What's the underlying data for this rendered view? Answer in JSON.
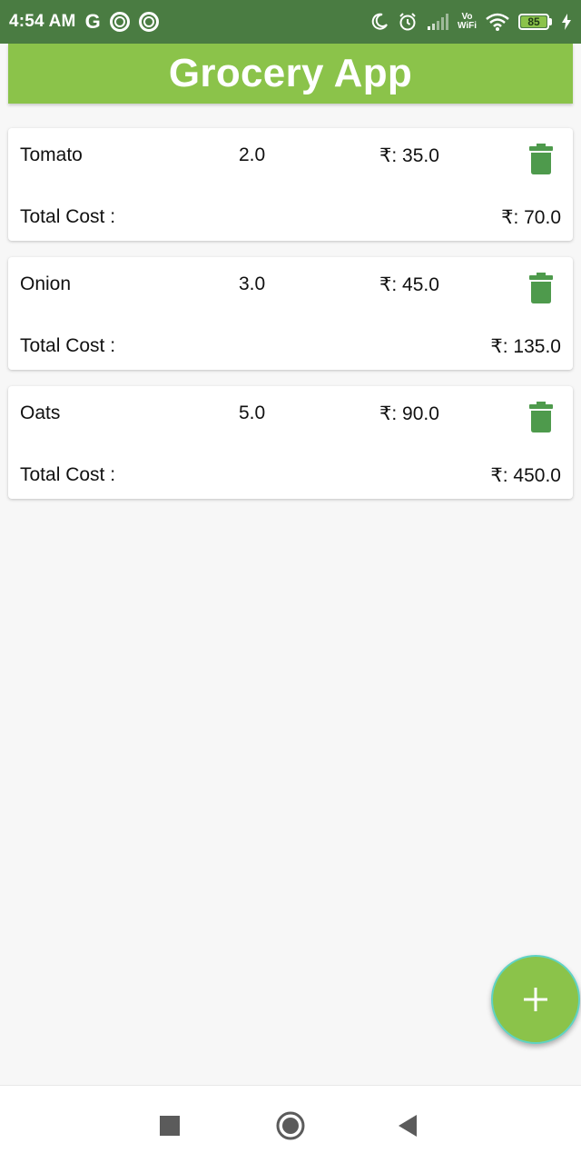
{
  "status_bar": {
    "time": "4:54 AM",
    "g_label": "G",
    "vowifi_top": "Vo",
    "vowifi_bottom": "WiFi",
    "battery": "85"
  },
  "app_bar": {
    "title": "Grocery App"
  },
  "items": [
    {
      "name": "Tomato",
      "quantity": "2.0",
      "price": "₹: 35.0",
      "total_label": "Total Cost :",
      "total": "₹: 70.0"
    },
    {
      "name": "Onion",
      "quantity": "3.0",
      "price": "₹: 45.0",
      "total_label": "Total Cost :",
      "total": "₹: 135.0"
    },
    {
      "name": "Oats",
      "quantity": "5.0",
      "price": "₹: 90.0",
      "total_label": "Total Cost :",
      "total": "₹: 450.0"
    }
  ],
  "colors": {
    "status_bar": "#4a7c42",
    "app_bar": "#8bc34a",
    "delete_icon": "#4e9a4c",
    "fab": "#8bc34a"
  },
  "icons": {
    "delete": "trash-icon",
    "fab": "plus-icon",
    "nav_recents": "square-icon",
    "nav_home": "circle-icon",
    "nav_back": "triangle-back-icon"
  }
}
